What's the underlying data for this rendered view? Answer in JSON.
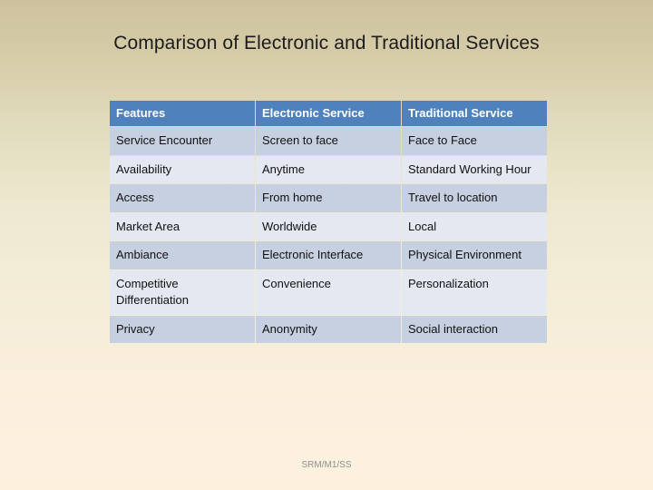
{
  "slide": {
    "title": "Comparison of Electronic and Traditional Services",
    "footer": "SRM/M1/SS",
    "colors": {
      "header_blue": "#4F81BD",
      "row_dark": "#C7D0E1",
      "row_light": "#E3E8F1",
      "background_top": "#CDC29D",
      "background_bottom": "#FDF1DE",
      "title_text": "#1B1B1B",
      "footer_text": "#8E8E8E"
    }
  },
  "table": {
    "headers": [
      "Features",
      "Electronic Service",
      "Traditional Service"
    ],
    "rows": [
      {
        "feature": "Service Encounter",
        "electronic": "Screen to face",
        "traditional": "Face to Face"
      },
      {
        "feature": "Availability",
        "electronic": "Anytime",
        "traditional": "Standard Working Hour"
      },
      {
        "feature": "Access",
        "electronic": "From home",
        "traditional": "Travel to location"
      },
      {
        "feature": "Market Area",
        "electronic": "Worldwide",
        "traditional": "Local"
      },
      {
        "feature": "Ambiance",
        "electronic": "Electronic Interface",
        "traditional": "Physical Environment"
      },
      {
        "feature": "Competitive Differentiation",
        "electronic": "Convenience",
        "traditional": "Personalization"
      },
      {
        "feature": "Privacy",
        "electronic": "Anonymity",
        "traditional": "Social interaction"
      }
    ]
  }
}
